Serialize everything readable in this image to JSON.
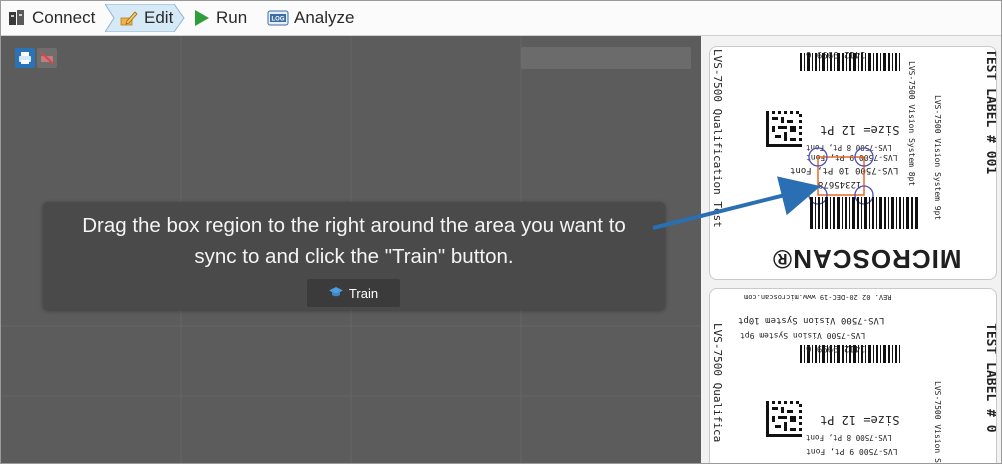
{
  "steps": [
    {
      "label": "Connect"
    },
    {
      "label": "Edit"
    },
    {
      "label": "Run"
    },
    {
      "label": "Analyze"
    }
  ],
  "analyze_icon_text": "LOG",
  "overlay": {
    "line1": "Drag the box region to the right around the area you want to",
    "line2": "sync to and click the \"Train\" button.",
    "train_label": "Train"
  },
  "label1": {
    "serial": "1412 9999 6",
    "left_edge": "LVS-7500 Qualification Test",
    "size_line": "Size= 12 Pt",
    "font_8": "LVS-7500 8 Pt, Font",
    "font_9": "LVS-7500 9 Pt, Font",
    "font_10": "LVS-7500 10 Pt, Font",
    "code": "12345678",
    "side_1": "LVS-7500 Vision System 8pt",
    "side_2": "LVS-7500 Vision System 9pt",
    "side_title": "TEST LABEL # 001",
    "brand": "MICROSCAN®"
  },
  "label2": {
    "website": "REV. 02  20-DEC-19   www.microscan.com",
    "sys10": "LVS-7500 Vision System 10pt",
    "sys9": "LVS-7500 Vision System 9pt",
    "serial": "1412 9999 6",
    "left_edge": "LVS-7500 Qualifica",
    "size_line": "Size= 12 Pt",
    "font_8": "LVS-7500 8 Pt, Font",
    "font_9": "LVS-7500 9 Pt, Font",
    "side_1": "LVS-7500 Vision Sys",
    "side_title": "TEST LABEL # 0"
  },
  "colors": {
    "accent": "#2b73b7",
    "workspace": "#5d5c5c",
    "overlay": "#4a4a4a",
    "edit_step": "#d6e9f6"
  }
}
